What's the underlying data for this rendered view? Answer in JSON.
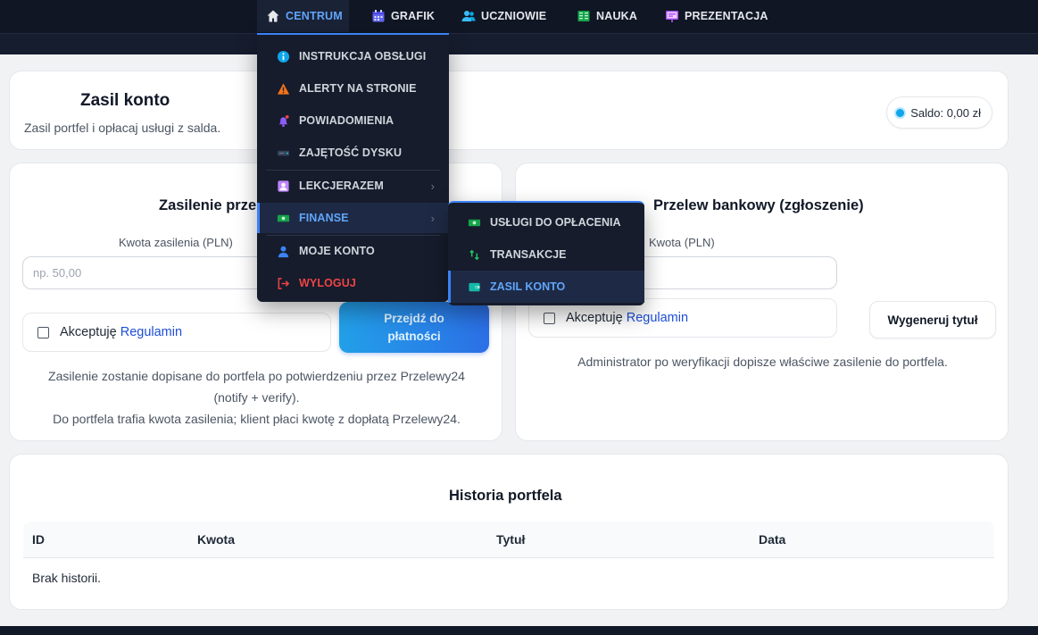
{
  "nav": {
    "items": [
      {
        "label": "CENTRUM",
        "icon": "home-icon"
      },
      {
        "label": "GRAFIK",
        "icon": "calendar-icon"
      },
      {
        "label": "UCZNIOWIE",
        "icon": "users-icon"
      },
      {
        "label": "NAUKA",
        "icon": "book-icon"
      },
      {
        "label": "PREZENTACJA",
        "icon": "presentation-icon"
      }
    ]
  },
  "dropdown": {
    "items": [
      {
        "label": "INSTRUKCJA OBSŁUGI",
        "icon": "info-icon"
      },
      {
        "label": "ALERTY NA STRONIE",
        "icon": "warning-icon"
      },
      {
        "label": "POWIADOMIENIA",
        "icon": "bell-icon"
      },
      {
        "label": "ZAJĘTOŚĆ DYSKU",
        "icon": "disk-icon"
      },
      {
        "label": "LEKCJERAZEM",
        "icon": "portrait-icon",
        "chevron": "›"
      },
      {
        "label": "FINANSE",
        "icon": "money-icon",
        "chevron": "›"
      },
      {
        "label": "MOJE KONTO",
        "icon": "user-icon"
      },
      {
        "label": "WYLOGUJ",
        "icon": "logout-icon"
      }
    ]
  },
  "submenu": {
    "items": [
      {
        "label": "USŁUGI DO OPŁACENIA",
        "icon": "money-icon"
      },
      {
        "label": "TRANSAKCJE",
        "icon": "refresh-icon"
      },
      {
        "label": "ZASIL KONTO",
        "icon": "wallet-icon"
      }
    ]
  },
  "header": {
    "title": "Zasil konto",
    "subtitle": "Zasil portfel i opłacaj usługi z salda.",
    "balance": "Saldo: 0,00 zł"
  },
  "online": {
    "title": "Zasilenie prze",
    "amount_label": "Kwota zasilenia (PLN)",
    "amount_placeholder": "np. 50,00",
    "accept_text": "Akceptuję",
    "accept_link": "Regulamin",
    "pay_button": "Przejdź do płatności",
    "note_line1": "Zasilenie zostanie dopisane do portfela po potwierdzeniu przez Przelewy24",
    "note_line2": "(notify + verify).",
    "note_line3": "Do portfela trafia kwota zasilenia; klient płaci kwotę z dopłatą Przelewy24."
  },
  "transfer": {
    "title": "Przelew bankowy (zgłoszenie)",
    "amount_label": "Kwota (PLN)",
    "accept_text": "Akceptuję",
    "accept_link": "Regulamin",
    "generate_button": "Wygeneruj tytuł",
    "note": "Administrator po weryfikacji dopisze właściwe zasilenie do portfela."
  },
  "history": {
    "title": "Historia portfela",
    "columns": [
      "ID",
      "Kwota",
      "Tytuł",
      "Data"
    ],
    "empty": "Brak historii."
  },
  "colors": {
    "accent": "#3b82f6",
    "nav_bg": "#101624",
    "danger": "#ef4444"
  }
}
